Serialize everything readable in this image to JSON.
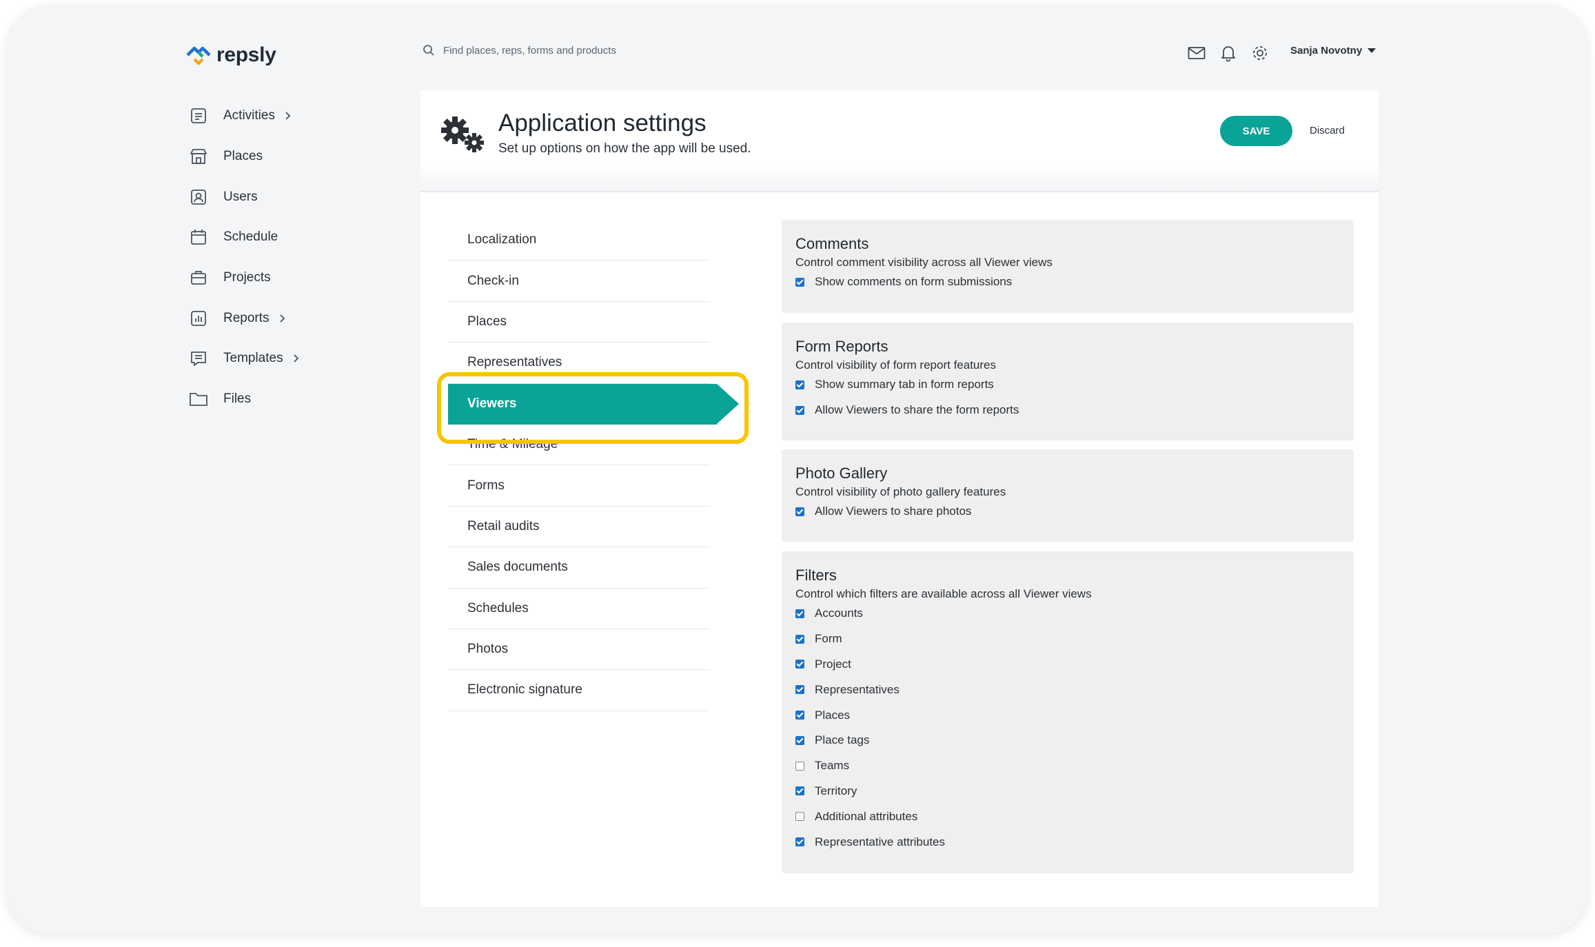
{
  "app": {
    "brand": "repsly"
  },
  "search": {
    "placeholder": "Find places, reps, forms and products"
  },
  "user": {
    "name": "Sanja Novotny"
  },
  "nav": [
    {
      "label": "Activities",
      "icon": "activities-icon",
      "chevron": true
    },
    {
      "label": "Places",
      "icon": "store-icon",
      "chevron": false
    },
    {
      "label": "Users",
      "icon": "user-badge-icon",
      "chevron": false
    },
    {
      "label": "Schedule",
      "icon": "calendar-icon",
      "chevron": false
    },
    {
      "label": "Projects",
      "icon": "briefcase-icon",
      "chevron": false
    },
    {
      "label": "Reports",
      "icon": "bar-chart-icon",
      "chevron": true
    },
    {
      "label": "Templates",
      "icon": "form-icon",
      "chevron": true
    },
    {
      "label": "Files",
      "icon": "folder-icon",
      "chevron": false
    }
  ],
  "header": {
    "title": "Application settings",
    "subtitle": "Set up options on how the app will be used.",
    "save_label": "SAVE",
    "discard_label": "Discard"
  },
  "menu": {
    "active_index": 4,
    "items": [
      "Localization",
      "Check-in",
      "Places",
      "Representatives",
      "Viewers",
      "Time & Mileage",
      "Forms",
      "Retail audits",
      "Sales documents",
      "Schedules",
      "Photos",
      "Electronic signature"
    ]
  },
  "panels": [
    {
      "title": "Comments",
      "description": "Control comment visibility across all Viewer views",
      "options": [
        {
          "label": "Show comments on form submissions",
          "checked": true
        }
      ]
    },
    {
      "title": "Form Reports",
      "description": "Control visibility of form report features",
      "options": [
        {
          "label": "Show summary tab in form reports",
          "checked": true
        },
        {
          "label": "Allow Viewers to share the form reports",
          "checked": true
        }
      ]
    },
    {
      "title": "Photo Gallery",
      "description": "Control visibility of photo gallery features",
      "options": [
        {
          "label": "Allow Viewers to share photos",
          "checked": true
        }
      ]
    },
    {
      "title": "Filters",
      "description": "Control which filters are available across all Viewer views",
      "options": [
        {
          "label": "Accounts",
          "checked": true
        },
        {
          "label": "Form",
          "checked": true
        },
        {
          "label": "Project",
          "checked": true
        },
        {
          "label": "Representatives",
          "checked": true
        },
        {
          "label": "Places",
          "checked": true
        },
        {
          "label": "Place tags",
          "checked": true
        },
        {
          "label": "Teams",
          "checked": false
        },
        {
          "label": "Territory",
          "checked": true
        },
        {
          "label": "Additional attributes",
          "checked": false
        },
        {
          "label": "Representative attributes",
          "checked": true
        }
      ]
    }
  ],
  "colors": {
    "accent": "#0aa398",
    "highlight": "#f6c600",
    "checkbox": "#1a73c9"
  }
}
